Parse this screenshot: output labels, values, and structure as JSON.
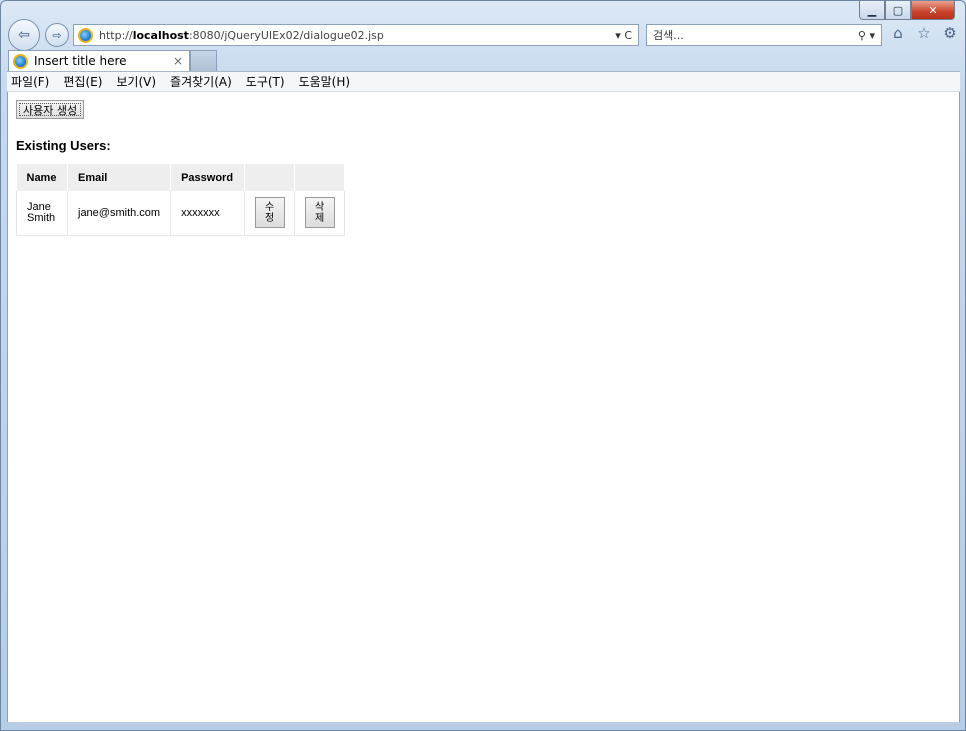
{
  "browser": {
    "url_prefix": "http://",
    "url_host": "localhost",
    "url_path": ":8080/jQueryUIEx02/dialogue02.jsp",
    "address_controls": "▾ C",
    "search_placeholder": "검색...",
    "tab_title": "Insert title here",
    "tab_close": "×"
  },
  "menu": [
    "파일(F)",
    "편집(E)",
    "보기(V)",
    "즐겨찾기(A)",
    "도구(T)",
    "도움말(H)"
  ],
  "page": {
    "create_button": "사용자 생성",
    "heading": "Existing Users:",
    "table": {
      "headers": [
        "Name",
        "Email",
        "Password",
        "",
        ""
      ],
      "rows": [
        {
          "name": "Jane Smith",
          "email": "jane@smith.com",
          "password": "xxxxxxx",
          "edit_label": "수정",
          "delete_label": "삭제"
        }
      ]
    }
  },
  "icons": {
    "back": "arrow-left-icon",
    "forward": "arrow-right-icon",
    "home": "home-icon",
    "favorites": "star-icon",
    "tools": "gear-icon"
  }
}
